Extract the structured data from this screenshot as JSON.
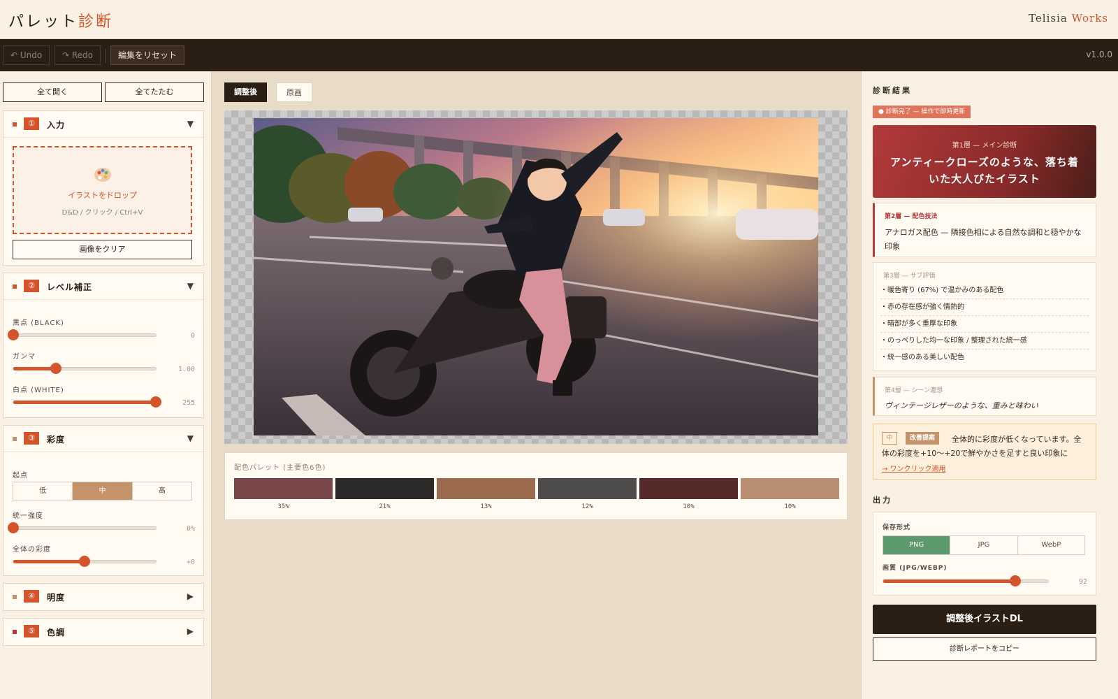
{
  "header": {
    "title_main": "パレット",
    "title_accent": "診断",
    "brand_main": "Telisia ",
    "brand_accent": "Works"
  },
  "toolbar": {
    "undo": "↶ Undo",
    "redo": "↷ Redo",
    "reset": "編集をリセット",
    "version": "v1.0.0"
  },
  "left": {
    "expand_all": "全て開く",
    "collapse_all": "全てたたむ",
    "panels": [
      {
        "num": "①",
        "title": "入力",
        "arrow": "▼"
      },
      {
        "num": "②",
        "title": "レベル補正",
        "arrow": "▼"
      },
      {
        "num": "③",
        "title": "彩度",
        "arrow": "▼"
      },
      {
        "num": "④",
        "title": "明度",
        "arrow": "▶"
      },
      {
        "num": "⑤",
        "title": "色調",
        "arrow": "▶"
      }
    ],
    "input": {
      "drop_title": "イラストをドロップ",
      "drop_hint": "D&D / クリック / Ctrl+V",
      "clear": "画像をクリア"
    },
    "levels": {
      "black_label": "黒点 (BLACK)",
      "black_value": "0",
      "black_pct": 0,
      "gamma_label": "ガンマ",
      "gamma_value": "1.00",
      "gamma_pct": 0.3,
      "white_label": "白点 (WHITE)",
      "white_value": "255",
      "white_pct": 1.0
    },
    "saturation": {
      "origin_label": "起点",
      "options": [
        "低",
        "中",
        "高"
      ],
      "selected": "中",
      "unify_label": "統一強度",
      "unify_value": "0%",
      "unify_pct": 0,
      "overall_label": "全体の彩度",
      "overall_value": "+0",
      "overall_pct": 0.5
    }
  },
  "center": {
    "tab_after": "調整後",
    "tab_original": "原画",
    "palette_title": "配色パレット (主要色6色)",
    "palette": [
      {
        "color": "#7a4748",
        "pct": "35%"
      },
      {
        "color": "#2c2a29",
        "pct": "21%"
      },
      {
        "color": "#9c6a4c",
        "pct": "13%"
      },
      {
        "color": "#4f4d4c",
        "pct": "12%"
      },
      {
        "color": "#562a29",
        "pct": "10%"
      },
      {
        "color": "#b98e71",
        "pct": "10%"
      }
    ]
  },
  "right": {
    "diag_title": "診断結果",
    "status": "● 診断完了 — 操作で即時更新",
    "layer1_label": "第1層 — メイン診断",
    "layer1_value": "アンティークローズのような、落ち着いた大人びたイラスト",
    "layer2_label": "第2層 — 配色技法",
    "layer2_value": "アナロガス配色 — 隣接色相による自然な調和と穏やかな印象",
    "layer3_label": "第3層 — サブ評価",
    "layer3_items": [
      "・暖色寄り (67%) で温かみのある配色",
      "・赤の存在感が強く情熱的",
      "・暗部が多く重厚な印象",
      "・のっぺりした均一な印象 / 整理された統一感",
      "・統一感のある美しい配色"
    ],
    "layer4_label": "第4層 — シーン連想",
    "layer4_value": "ヴィンテージレザーのような、重みと味わい",
    "suggest_level": "中",
    "suggest_tag": "改善提案",
    "suggest_text": "全体的に彩度が低くなっています。全体の彩度を+10〜+20で鮮やかさを足すと良い印象に",
    "suggest_link": "→ ワンクリック適用",
    "output_title": "出力",
    "format_label": "保存形式",
    "formats": [
      "PNG",
      "JPG",
      "WebP"
    ],
    "format_selected": "PNG",
    "quality_label": "画質 (JPG/WEBP)",
    "quality_value": "92",
    "quality_pct": 0.8,
    "download": "調整後イラストDL",
    "copy_report": "診断レポートをコピー"
  },
  "colors": {
    "accent": "#d4542c",
    "dark": "#2b1e15",
    "panel_bg": "#faf1e4",
    "format_active": "#5c9a6e",
    "layer1_bg": "#b33a3a"
  }
}
